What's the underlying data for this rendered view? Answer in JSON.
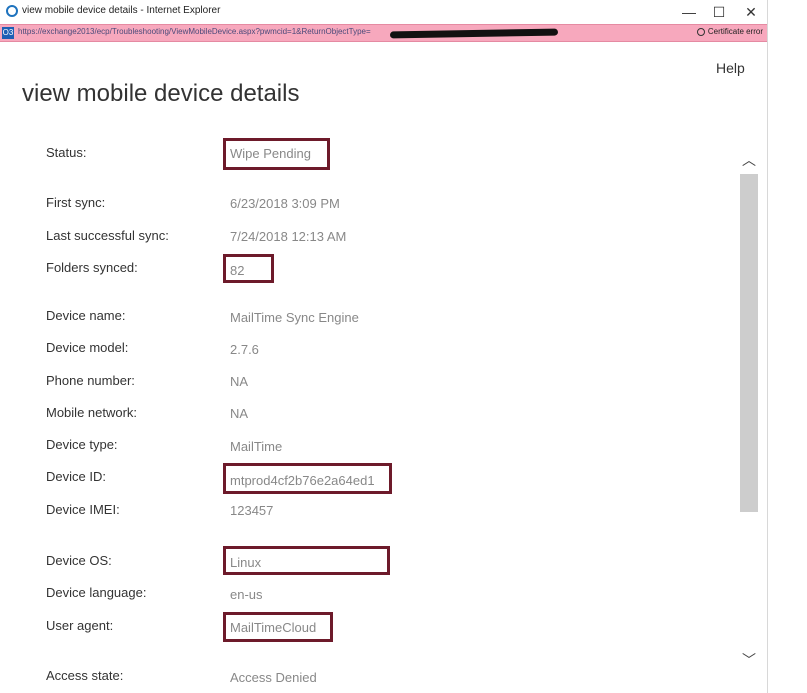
{
  "window": {
    "title": "view mobile device details - Internet Explorer",
    "minimize": "—",
    "maximize": "☐",
    "close": "✕"
  },
  "addressbar": {
    "url": "https://exchange2013/ecp/Troubleshooting/ViewMobileDevice.aspx?pwmcid=1&ReturnObjectType=",
    "site_icon": "O3",
    "certificate_error": "Certificate error"
  },
  "page": {
    "title": "view mobile device details",
    "help": "Help"
  },
  "fields": [
    {
      "label": "Status:",
      "value": "Wipe Pending"
    },
    {
      "label": "First sync:",
      "value": "6/23/2018 3:09 PM"
    },
    {
      "label": "Last successful sync:",
      "value": "7/24/2018 12:13 AM"
    },
    {
      "label": "Folders synced:",
      "value": "82"
    },
    {
      "label": "Device name:",
      "value": "MailTime Sync Engine"
    },
    {
      "label": "Device model:",
      "value": "2.7.6"
    },
    {
      "label": "Phone number:",
      "value": "NA"
    },
    {
      "label": "Mobile network:",
      "value": "NA"
    },
    {
      "label": "Device type:",
      "value": "MailTime"
    },
    {
      "label": "Device ID:",
      "value": "mtprod4cf2b76e2a64ed1"
    },
    {
      "label": "Device IMEI:",
      "value": "123457"
    },
    {
      "label": "Device OS:",
      "value": "Linux"
    },
    {
      "label": "Device language:",
      "value": "en-us"
    },
    {
      "label": "User agent:",
      "value": "MailTimeCloud"
    },
    {
      "label": "Access state:",
      "value": "Access Denied"
    }
  ],
  "scrollbar": {
    "up": "︿",
    "down": "﹀"
  },
  "colors": {
    "address_bar": "#f7a8bd",
    "highlight_border": "#6d1a2a",
    "value_text": "#888888"
  }
}
